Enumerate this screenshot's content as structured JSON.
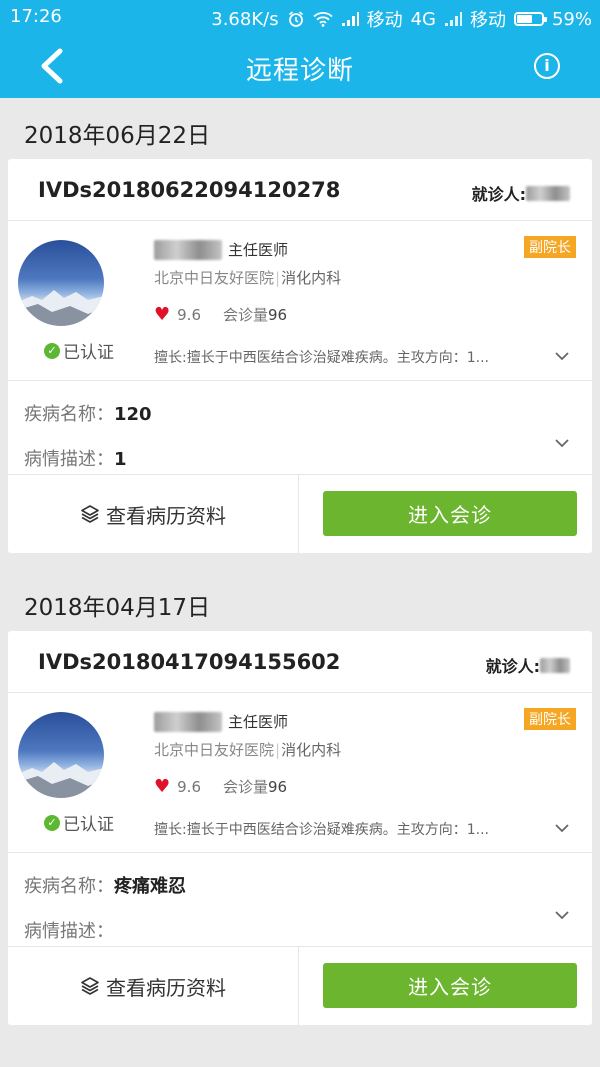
{
  "status_bar": {
    "time": "17:26",
    "network_speed": "3.68K/s",
    "carrier_1": "移动",
    "network_type": "4G",
    "carrier_2": "移动",
    "battery": "59%"
  },
  "nav": {
    "title": "远程诊断",
    "back_icon": "chevron-left-icon",
    "info_icon": "info-icon",
    "info_glyph": "i"
  },
  "consultations": [
    {
      "date": "2018年06月22日",
      "order_no": "IVDs20180622094120278",
      "patient_label": "就诊人:",
      "doctor": {
        "title": "主任医师",
        "role_badge": "副院长",
        "hospital": "北京中日友好医院",
        "department": "消化内科",
        "rating": "9.6",
        "consult_count_label": "会诊量",
        "consult_count": "96",
        "verified_label": "已认证",
        "specialty": "擅长:擅长于中西医结合诊治疑难疾病。主攻方向：1..."
      },
      "disease_name_label": "疾病名称：",
      "disease_name": "120",
      "description_label": "病情描述：",
      "description": "1",
      "records_button": "查看病历资料",
      "enter_button": "进入会诊"
    },
    {
      "date": "2018年04月17日",
      "order_no": "IVDs20180417094155602",
      "patient_label": "就诊人:",
      "doctor": {
        "title": "主任医师",
        "role_badge": "副院长",
        "hospital": "北京中日友好医院",
        "department": "消化内科",
        "rating": "9.6",
        "consult_count_label": "会诊量",
        "consult_count": "96",
        "verified_label": "已认证",
        "specialty": "擅长:擅长于中西医结合诊治疑难疾病。主攻方向：1..."
      },
      "disease_name_label": "疾病名称：",
      "disease_name": "疼痛难忍",
      "description_label": "病情描述：",
      "description": "",
      "records_button": "查看病历资料",
      "enter_button": "进入会诊"
    }
  ],
  "colors": {
    "primary": "#1bb5ea",
    "accent_green": "#6bb52f",
    "badge_orange": "#f5a623",
    "heart_red": "#e0112b"
  }
}
